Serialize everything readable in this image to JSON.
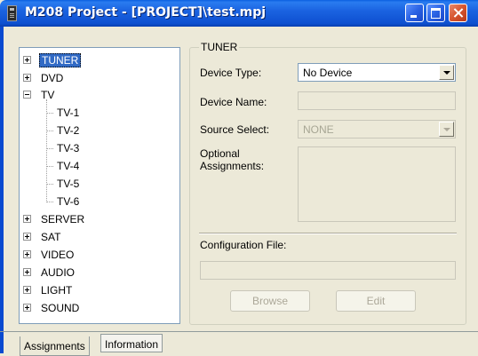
{
  "window": {
    "title": "M208 Project - [PROJECT]\\test.mpj"
  },
  "tree": {
    "items": [
      {
        "label": "TUNER",
        "expander": "plus",
        "selected": true
      },
      {
        "label": "DVD",
        "expander": "plus"
      },
      {
        "label": "TV",
        "expander": "minus",
        "children": [
          "TV-1",
          "TV-2",
          "TV-3",
          "TV-4",
          "TV-5",
          "TV-6"
        ]
      },
      {
        "label": "SERVER",
        "expander": "plus"
      },
      {
        "label": "SAT",
        "expander": "plus"
      },
      {
        "label": "VIDEO",
        "expander": "plus"
      },
      {
        "label": "AUDIO",
        "expander": "plus"
      },
      {
        "label": "LIGHT",
        "expander": "plus"
      },
      {
        "label": "SOUND",
        "expander": "plus"
      }
    ]
  },
  "panel": {
    "title": "TUNER",
    "device_type_label": "Device Type:",
    "device_type_value": "No Device",
    "device_name_label": "Device Name:",
    "device_name_value": "",
    "source_select_label": "Source Select:",
    "source_select_value": "NONE",
    "optional_label_1": "Optional",
    "optional_label_2": "Assignments:",
    "config_file_label": "Configuration File:",
    "config_file_value": "",
    "browse_label": "Browse",
    "edit_label": "Edit"
  },
  "tabs": [
    {
      "label": "Assignments",
      "active": true
    },
    {
      "label": "Information",
      "active": false
    }
  ],
  "colors": {
    "titlebar": "#0d50d0",
    "selection": "#316ac5",
    "window_bg": "#ece9d8"
  }
}
